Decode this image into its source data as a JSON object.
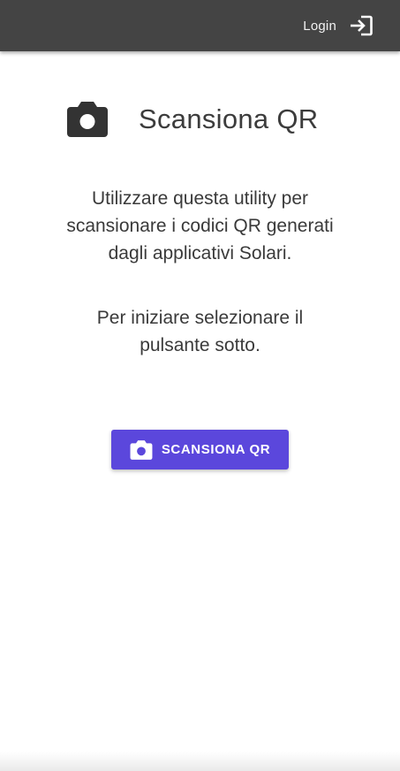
{
  "header": {
    "login_label": "Login",
    "login_icon": "login-arrow-icon",
    "background_color": "#444444"
  },
  "main": {
    "title": "Scansiona QR",
    "title_icon": "camera-icon",
    "intro_lines": [
      "Utilizzare questa utility per",
      "scansionare i codici QR generati",
      "dagli applicativi Solari."
    ],
    "start_lines": [
      "Per iniziare selezionare il",
      "pulsante sotto."
    ]
  },
  "scan_button": {
    "label": "SCANSIONA QR",
    "icon": "camera-icon",
    "color": "#5b47dc"
  }
}
